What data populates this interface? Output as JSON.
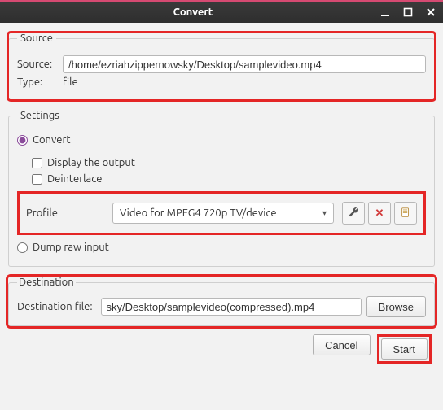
{
  "window": {
    "title": "Convert"
  },
  "source_box": {
    "legend": "Source",
    "source_label": "Source:",
    "source_value": "/home/ezriahzippernowsky/Desktop/samplevideo.mp4",
    "type_label": "Type:",
    "type_value": "file"
  },
  "settings_box": {
    "legend": "Settings",
    "convert_label": "Convert",
    "display_output_label": "Display the output",
    "deinterlace_label": "Deinterlace",
    "profile_label": "Profile",
    "profile_value": "Video for MPEG4 720p TV/device",
    "dump_label": "Dump raw input"
  },
  "destination_box": {
    "legend": "Destination",
    "dest_label": "Destination file:",
    "dest_value": "sky/Desktop/samplevideo(compressed).mp4",
    "browse_label": "Browse"
  },
  "footer": {
    "cancel_label": "Cancel",
    "start_label": "Start"
  }
}
